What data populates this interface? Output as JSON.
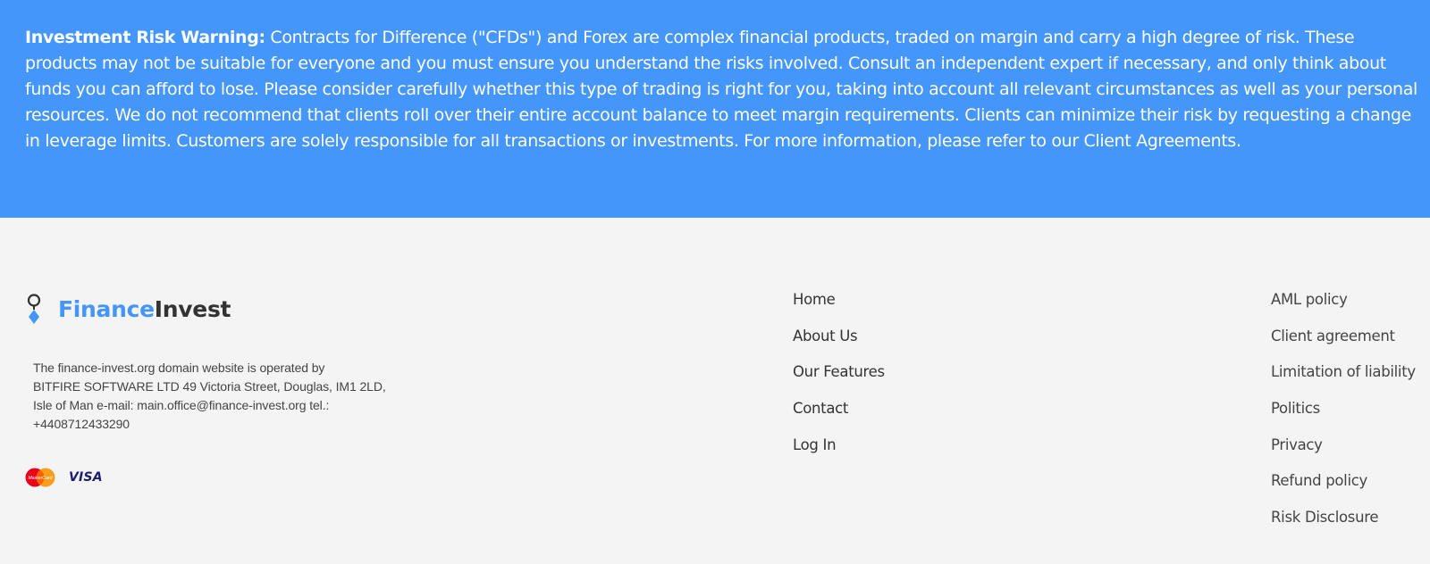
{
  "risk_warning": {
    "label": "Investment Risk Warning:",
    "text": " Contracts for Difference (\"CFDs\") and Forex are complex financial products, traded on margin and carry a high degree of risk. These products may not be suitable for everyone and you must ensure you understand the risks involved. Consult an independent expert if necessary, and only think about funds you can afford to lose. Please consider carefully whether this type of trading is right for you, taking into account all relevant circumstances as well as your personal resources. We do not recommend that clients roll over their entire account balance to meet margin requirements. Clients can minimize their risk by requesting a change in leverage limits. Customers are solely responsible for all transactions or investments. For more information, please refer to our Client Agreements.",
    "background_color": "#4596fa"
  },
  "brand": {
    "name_part1": "Finance",
    "name_part2": "Invest",
    "accent_color": "#4596fa",
    "icon": "location-pin-icon"
  },
  "company_info": {
    "line1": "The finance-invest.org domain website is operated by",
    "line2": "BITFIRE SOFTWARE LTD 49 Victoria Street, Douglas, IM1 2LD,",
    "line3": "Isle of Man e-mail: main.office@finance-invest.org tel.:",
    "line4": "+4408712433290"
  },
  "payments": {
    "mastercard_icon": "mastercard-icon",
    "mastercard_text": "MasterCard",
    "visa_text": "VISA"
  },
  "nav_main": [
    {
      "label": "Home"
    },
    {
      "label": "About Us"
    },
    {
      "label": "Our Features"
    },
    {
      "label": "Contact"
    },
    {
      "label": "Log In"
    }
  ],
  "nav_legal": [
    {
      "label": "AML policy"
    },
    {
      "label": "Client agreement"
    },
    {
      "label": "Limitation of liability"
    },
    {
      "label": "Politics"
    },
    {
      "label": "Privacy"
    },
    {
      "label": "Refund policy"
    },
    {
      "label": "Risk Disclosure"
    }
  ]
}
